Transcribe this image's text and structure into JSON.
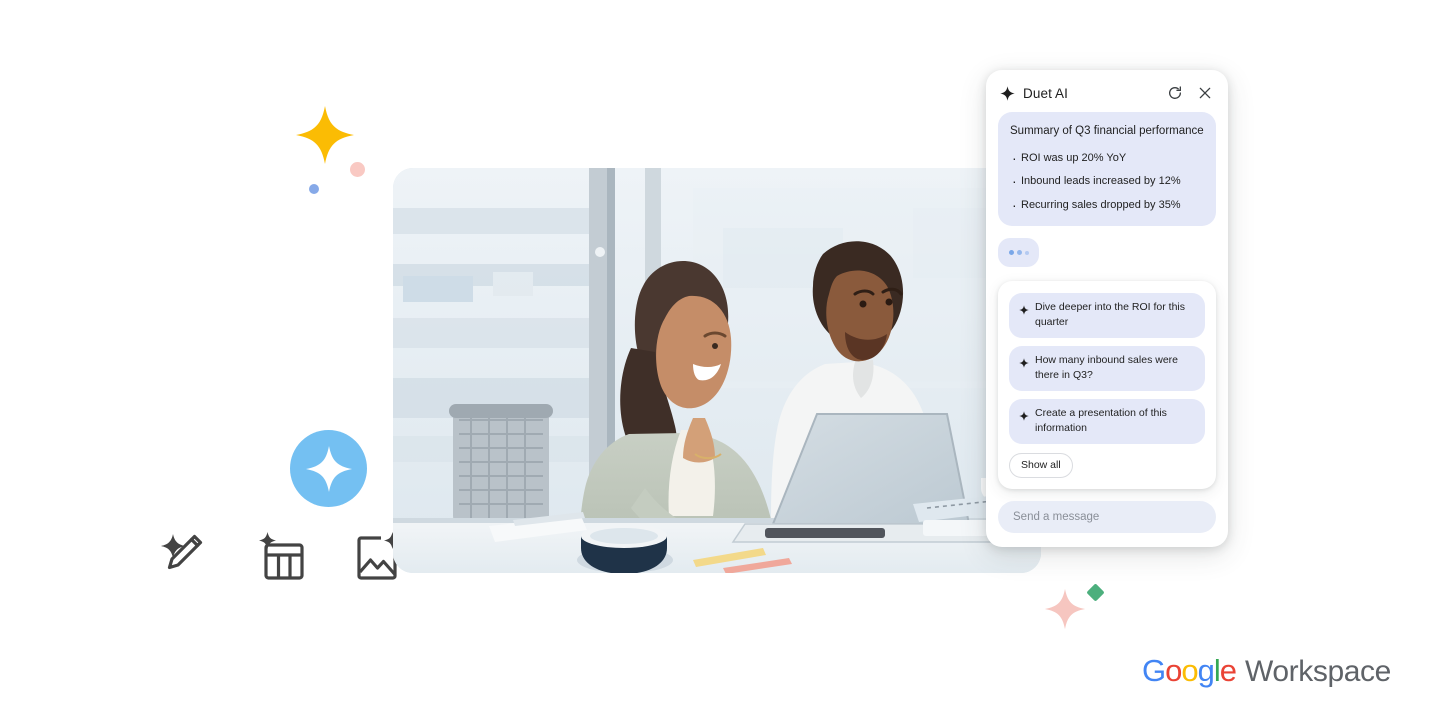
{
  "panel": {
    "title": "Duet AI",
    "brand_icon": "sparkle-icon",
    "refresh_icon": "refresh-icon",
    "close_icon": "close-icon",
    "message": {
      "title": "Summary of Q3 financial performance",
      "bullets": [
        "ROI was up 20% YoY",
        "Inbound leads increased by 12%",
        "Recurring sales dropped by 35%"
      ],
      "bubble_color": "#e4e8f8"
    },
    "typing_indicator": {
      "dot_color": "#7aa7e8",
      "dots": 3
    },
    "suggestions": [
      {
        "icon": "sparkle-icon",
        "label": "Dive deeper into the ROI for this quarter"
      },
      {
        "icon": "sparkle-icon",
        "label": "How many inbound sales were there in Q3?"
      },
      {
        "icon": "sparkle-icon",
        "label": "Create a presentation of this information"
      }
    ],
    "show_all_label": "Show all",
    "composer_placeholder": "Send a message"
  },
  "photo": {
    "alt": "Two colleagues smiling at a laptop in a bright office",
    "corner_radius_px": 20
  },
  "feature_icons": [
    {
      "name": "magic-pencil-icon"
    },
    {
      "name": "table-sparkle-icon"
    },
    {
      "name": "image-sparkle-icon"
    }
  ],
  "decorations": {
    "star_yellow_color": "#FBBC04",
    "dot_pink_color": "#f9c9c3",
    "dot_blue_color": "#86a9e8",
    "badge_circle_color": "#74c0f2",
    "badge_sparkle_color": "#ffffff",
    "star_pink_color": "#f6c6c0",
    "diamond_green_color": "#4caf7d"
  },
  "logo": {
    "google": [
      {
        "letter": "G",
        "color": "#4285F4"
      },
      {
        "letter": "o",
        "color": "#EA4335"
      },
      {
        "letter": "o",
        "color": "#FBBC04"
      },
      {
        "letter": "g",
        "color": "#4285F4"
      },
      {
        "letter": "l",
        "color": "#34A853"
      },
      {
        "letter": "e",
        "color": "#EA4335"
      }
    ],
    "workspace": "Workspace",
    "workspace_color": "#5f6368"
  }
}
